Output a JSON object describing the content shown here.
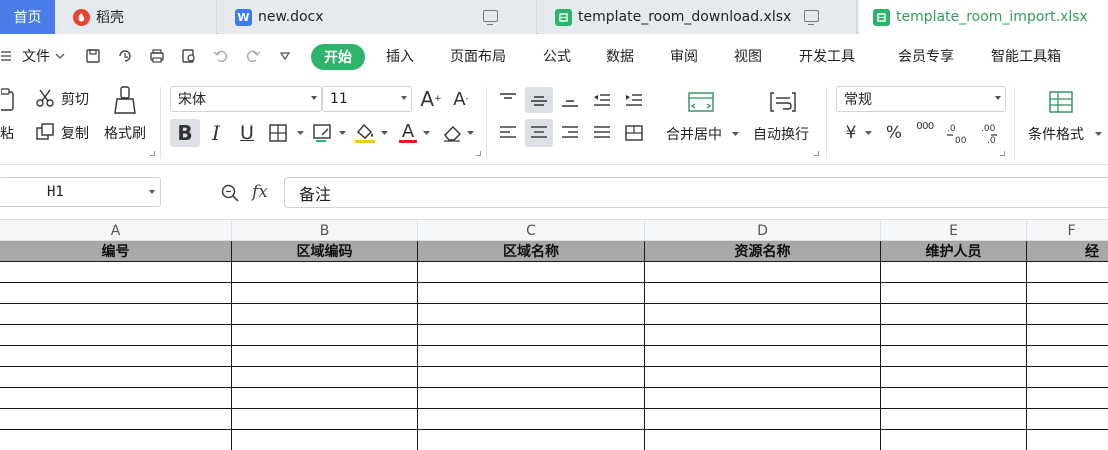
{
  "tabs": [
    {
      "label": "首页",
      "icon": "home-tab",
      "active": false
    },
    {
      "label": "稻壳",
      "icon": "docer-icon",
      "active": false
    },
    {
      "label": "new.docx",
      "icon": "word-icon",
      "active": false
    },
    {
      "label": "template_room_download.xlsx",
      "icon": "sheet-icon",
      "active": false
    },
    {
      "label": "template_room_import.xlsx",
      "icon": "sheet-icon",
      "active": true
    }
  ],
  "menu": {
    "file_label": "文件",
    "items": [
      "开始",
      "插入",
      "页面布局",
      "公式",
      "数据",
      "审阅",
      "视图",
      "开发工具",
      "会员专享",
      "智能工具箱"
    ]
  },
  "ribbon": {
    "cut_label": "剪切",
    "paste_label": "粘",
    "copy_label": "复制",
    "format_painter_label": "格式刷",
    "font_name": "宋体",
    "font_size": "11",
    "merge_label": "合并居中",
    "wrap_label": "自动换行",
    "number_format": "常规",
    "currency_symbol": "¥",
    "percent_symbol": "%",
    "thousands_symbol": "000",
    "cond_format_label": "条件格式"
  },
  "formula_bar": {
    "cell_ref": "H1",
    "fx_label": "fx",
    "content": "备注"
  },
  "sheet": {
    "columns": [
      "A",
      "B",
      "C",
      "D",
      "E",
      "F"
    ],
    "header_row": [
      "编号",
      "区域编码",
      "区域名称",
      "资源名称",
      "维护人员",
      "经"
    ],
    "empty_rows": 9
  },
  "colors": {
    "accent": "#2db36a",
    "active_tab_text": "#2f9e5b",
    "home_tab": "#4a7de9",
    "header_fill": "#a8a8a8"
  }
}
